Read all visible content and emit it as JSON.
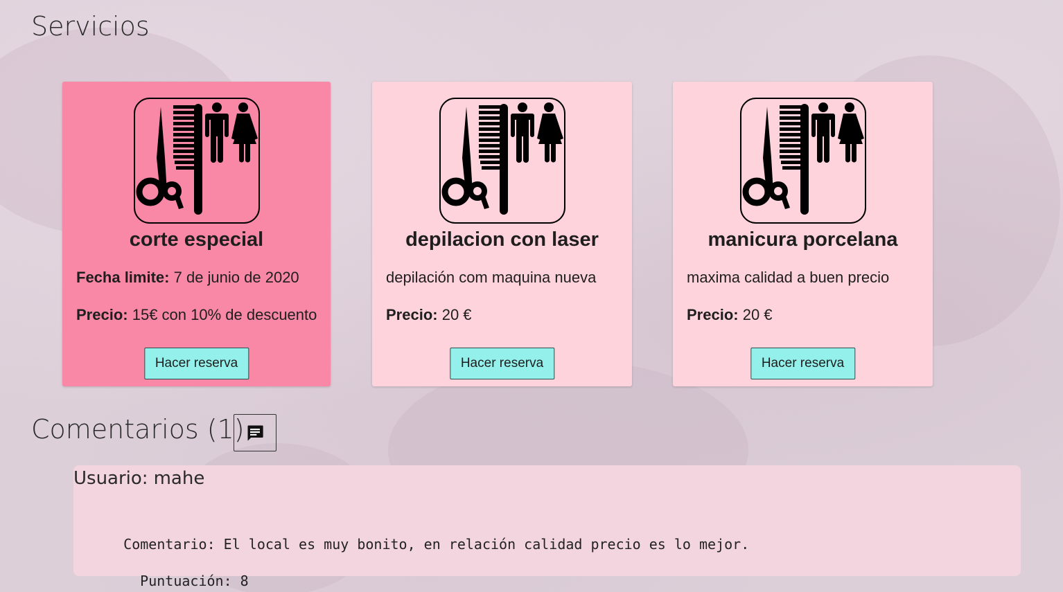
{
  "sections": {
    "services_title": "Servicios",
    "comments_title": "Comentarios (1)"
  },
  "services": [
    {
      "title": "corte especial",
      "line1_label": "Fecha limite:",
      "line1_value": "7 de junio de 2020",
      "price_label": "Precio:",
      "price_value": "15€ con 10% de descuento",
      "button": "Hacer reserva",
      "bg_color": "#f888a6",
      "icon": "hairdresser-logo-icon"
    },
    {
      "title": "depilacion con laser",
      "description": "depilación com maquina nueva",
      "price_label": "Precio:",
      "price_value": "20 €",
      "button": "Hacer reserva",
      "bg_color": "#ffd3dc",
      "icon": "hairdresser-logo-icon"
    },
    {
      "title": "manicura porcelana",
      "description": "maxima calidad a buen precio",
      "price_label": "Precio:",
      "price_value": "20 €",
      "button": "Hacer reserva",
      "bg_color": "#ffd3dc",
      "icon": "hairdresser-logo-icon"
    }
  ],
  "comments": [
    {
      "user_label": "Usuario:",
      "user": "mahe",
      "comment_label": "Comentario:",
      "comment": "El local es muy bonito, en relación calidad precio es lo mejor.",
      "score_label": "Puntuación:",
      "score": "8"
    }
  ],
  "colors": {
    "button_bg": "#93f0ea",
    "comment_bg": "#f3d5df",
    "page_bg": "#dccfd8"
  },
  "icons": {
    "comment_button": "comment-icon"
  }
}
